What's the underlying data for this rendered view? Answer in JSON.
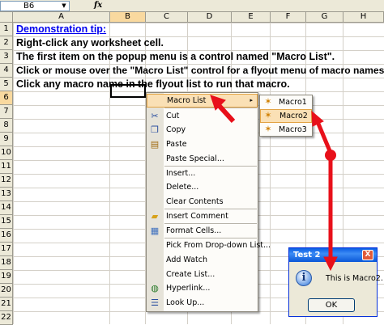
{
  "formula_bar": {
    "name_box": "B6",
    "fx": "fx"
  },
  "columns": [
    "A",
    "B",
    "C",
    "D",
    "E",
    "F",
    "G",
    "H"
  ],
  "rows": [
    "1",
    "2",
    "3",
    "4",
    "5",
    "6",
    "7",
    "8",
    "9",
    "10",
    "11",
    "12",
    "13",
    "14",
    "15",
    "16",
    "17",
    "18",
    "19",
    "20",
    "21",
    "22"
  ],
  "cells": {
    "a1": "Demonstration tip:",
    "a2": "Right-click any worksheet cell.",
    "a3": "The first item on the popup menu is a control named \"Macro List\".",
    "a4": "Click or mouse over the \"Macro List\" control for a flyout menu of macro names.",
    "a5": "Click any macro name in the flyout list to run that macro."
  },
  "context_menu": {
    "items": [
      {
        "label": "Macro List",
        "icon": "none",
        "submenu": "▸"
      },
      {
        "label": "Cut",
        "icon": "scissors-icon"
      },
      {
        "label": "Copy",
        "icon": "copy-icon"
      },
      {
        "label": "Paste",
        "icon": "paste-icon"
      },
      {
        "label": "Paste Special...",
        "icon": "none"
      },
      {
        "label": "Insert...",
        "icon": "none"
      },
      {
        "label": "Delete...",
        "icon": "none"
      },
      {
        "label": "Clear Contents",
        "icon": "none"
      },
      {
        "label": "Insert Comment",
        "icon": "comment-icon"
      },
      {
        "label": "Format Cells...",
        "icon": "format-cells-icon"
      },
      {
        "label": "Pick From Drop-down List...",
        "icon": "none"
      },
      {
        "label": "Add Watch",
        "icon": "none"
      },
      {
        "label": "Create List...",
        "icon": "none"
      },
      {
        "label": "Hyperlink...",
        "icon": "hyperlink-icon"
      },
      {
        "label": "Look Up...",
        "icon": "research-icon"
      }
    ]
  },
  "submenu": {
    "items": [
      "Macro1",
      "Macro2",
      "Macro3"
    ]
  },
  "dialog": {
    "title": "Test 2",
    "close": "X",
    "message": "This is Macro2.",
    "ok": "OK"
  },
  "colors": {
    "arrow": "#e8101a",
    "highlight": "#fae0b5",
    "highlight_border": "#e2a344",
    "titlebar": "#0a5de3"
  }
}
